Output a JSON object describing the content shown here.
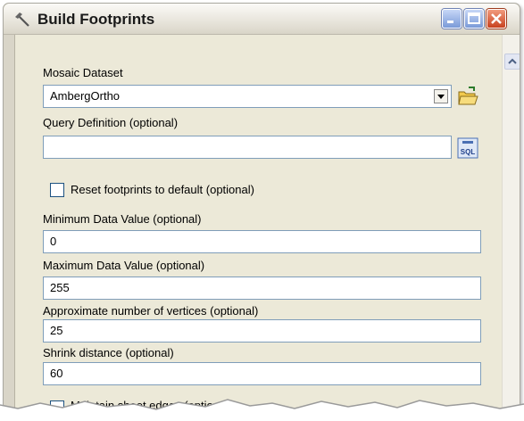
{
  "window": {
    "title": "Build Footprints"
  },
  "form": {
    "mosaic_dataset": {
      "label": "Mosaic Dataset",
      "value": "AmbergOrtho"
    },
    "query_definition": {
      "label": "Query Definition (optional)",
      "value": ""
    },
    "reset_footprints": {
      "label": "Reset footprints to default (optional)",
      "checked": false
    },
    "min_data_value": {
      "label": "Minimum Data Value (optional)",
      "value": "0"
    },
    "max_data_value": {
      "label": "Maximum Data Value (optional)",
      "value": "255"
    },
    "approx_vertices": {
      "label": "Approximate number of vertices (optional)",
      "value": "25"
    },
    "shrink_distance": {
      "label": "Shrink distance (optional)",
      "value": "60"
    },
    "maintain_sheet_edges": {
      "label": "Maintain sheet edges (optional)",
      "checked": false
    }
  },
  "icons": {
    "open_folder": "open-folder-icon",
    "sql": "sql-icon",
    "sql_text": "SQL"
  },
  "colors": {
    "field_border": "#7f9db9",
    "close_button": "#c8411f",
    "caption_buttons": "#7a9ad8"
  }
}
